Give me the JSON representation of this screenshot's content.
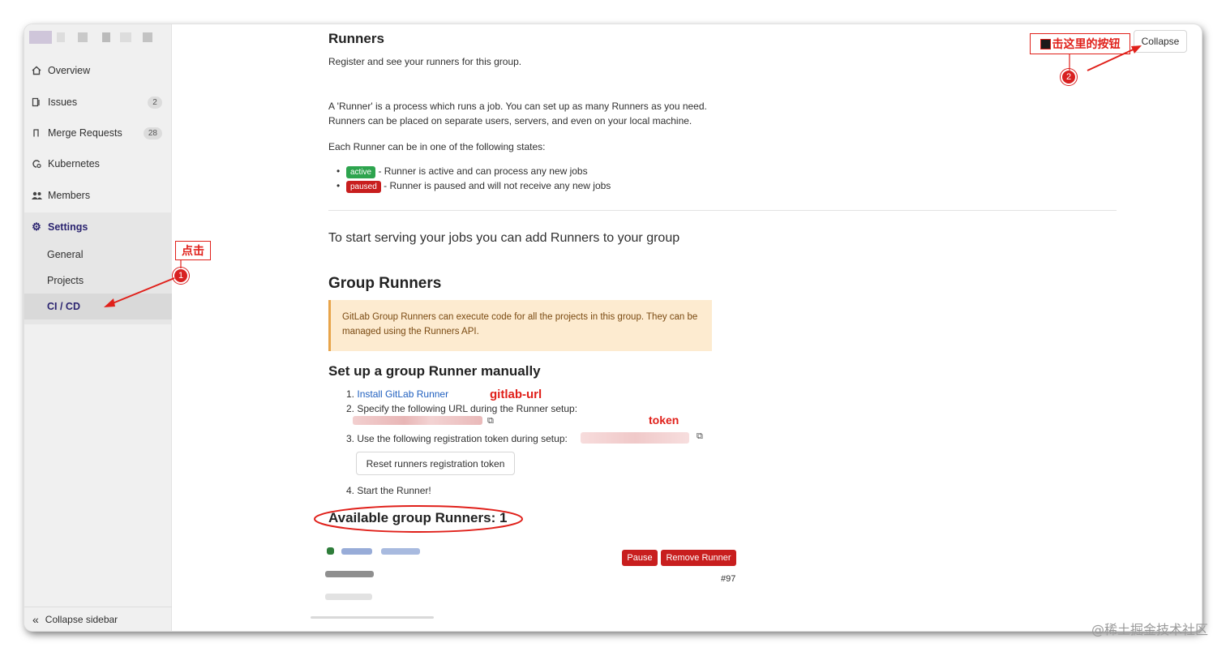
{
  "sidebar": {
    "items": [
      {
        "label": "Overview",
        "icon": "home-icon"
      },
      {
        "label": "Issues",
        "icon": "issues-icon",
        "count": "2"
      },
      {
        "label": "Merge Requests",
        "icon": "merge-request-icon",
        "count": "28"
      },
      {
        "label": "Kubernetes",
        "icon": "kubernetes-icon"
      },
      {
        "label": "Members",
        "icon": "members-icon"
      }
    ],
    "settings": {
      "label": "Settings",
      "icon": "gear-icon",
      "subitems": [
        "General",
        "Projects",
        "CI / CD"
      ]
    },
    "collapse_label": "Collapse sidebar"
  },
  "runners": {
    "title": "Runners",
    "subtitle": "Register and see your runners for this group.",
    "collapse_label": "Collapse",
    "desc_line1": "A 'Runner' is a process which runs a job. You can set up as many Runners as you need.",
    "desc_line2": "Runners can be placed on separate users, servers, and even on your local machine.",
    "states_intro": "Each Runner can be in one of the following states:",
    "state_active_badge": "active",
    "state_active_text": " - Runner is active and can process any new jobs",
    "state_paused_badge": "paused",
    "state_paused_text": " - Runner is paused and will not receive any new jobs",
    "start_serving": "To start serving your jobs you can add Runners to your group",
    "group_title": "Group Runners",
    "group_info": "GitLab Group Runners can execute code for all the projects in this group. They can be managed using the Runners API.",
    "setup_title": "Set up a group Runner manually",
    "step1_num": "1.",
    "step1_link": "Install GitLab Runner",
    "step2": "2. Specify the following URL during the Runner setup:",
    "step3": "3. Use the following registration token during setup:",
    "reset_button": "Reset runners registration token",
    "step4": "4. Start the Runner!",
    "available_title": "Available group Runners: 1",
    "pause_button": "Pause",
    "remove_button": "Remove Runner",
    "runner_id": "#97"
  },
  "annotations": {
    "click_label": "点击",
    "click_button_label": "击这里的按钮",
    "step_one": "1",
    "step_two": "2",
    "gitlab_url_label": "gitlab-url",
    "token_label": "token"
  },
  "watermark": "@稀土掘金技术社区",
  "colors": {
    "active_badge": "#2da44e",
    "paused_badge": "#c81e1e",
    "info_box_bg": "#fdebd0",
    "info_box_border": "#e8a44a",
    "link": "#1f5fbf",
    "annotation_red": "#e0201a"
  }
}
